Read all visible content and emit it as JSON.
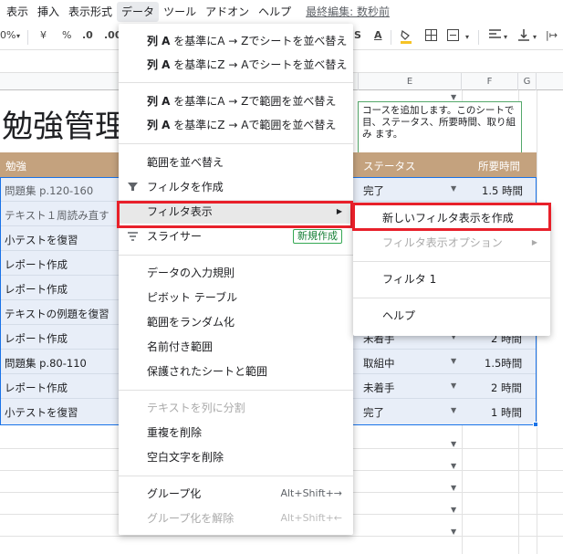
{
  "menubar": {
    "items": [
      "表示",
      "挿入",
      "表示形式",
      "データ",
      "ツール",
      "アドオン",
      "ヘルプ"
    ],
    "active_item": "データ",
    "last_edit": "最終編集: 数秒前"
  },
  "toolbar": {
    "zoom": "0%",
    "currency": "¥",
    "percent": "%",
    "dec_decrease": ".0",
    "dec_increase": ".00"
  },
  "sheet": {
    "columns": [
      "E",
      "F",
      "G"
    ],
    "title": "勉強管理",
    "note_text": "コースを追加します。このシートで 目、ステータス、所要時間、取り組み ます。",
    "headers": {
      "col_a": "勉強",
      "status": "ステータス",
      "time": "所要時間"
    },
    "rows": [
      {
        "task": "問題集 p.120-160",
        "status": "完了",
        "time": "1.5 時間"
      },
      {
        "task": "テキスト１周読み直す",
        "status": "",
        "time": ""
      },
      {
        "task": "小テストを復習",
        "status": "",
        "time": ""
      },
      {
        "task": "レポート作成",
        "status": "",
        "time": ""
      },
      {
        "task": "レポート作成",
        "status": "",
        "time": ""
      },
      {
        "task": "テキストの例題を復習",
        "status": "",
        "time": ""
      },
      {
        "task": "レポート作成",
        "status": "未着手",
        "time": "2 時間"
      },
      {
        "task": "問題集 p.80-110",
        "status": "取組中",
        "time": "1.5時間"
      },
      {
        "task": "レポート作成",
        "status": "未着手",
        "time": "2 時間"
      },
      {
        "task": "小テストを復習",
        "status": "完了",
        "time": "1 時間"
      }
    ]
  },
  "data_menu": {
    "sort_sheet_az": {
      "bold": "列 A",
      "rest": " を基準にA → Zでシートを並べ替え"
    },
    "sort_sheet_za": {
      "bold": "列 A",
      "rest": " を基準にZ → Aでシートを並べ替え"
    },
    "sort_range_az": {
      "bold": "列 A",
      "rest": " を基準にA → Zで範囲を並べ替え"
    },
    "sort_range_za": {
      "bold": "列 A",
      "rest": " を基準にZ → Aで範囲を並べ替え"
    },
    "sort_range": "範囲を並べ替え",
    "create_filter": "フィルタを作成",
    "filter_views": "フィルタ表示",
    "slicer": "スライサー",
    "slicer_badge": "新規作成",
    "data_validation": "データの入力規則",
    "pivot_table": "ピボット テーブル",
    "randomize_range": "範囲をランダム化",
    "named_ranges": "名前付き範囲",
    "protected_sheets": "保護されたシートと範囲",
    "split_text": "テキストを列に分割",
    "remove_duplicates": "重複を削除",
    "trim_whitespace": "空白文字を削除",
    "group": "グループ化",
    "group_shortcut": "Alt+Shift+→",
    "ungroup": "グループ化を解除",
    "ungroup_shortcut": "Alt+Shift+←"
  },
  "filter_submenu": {
    "new_filter_view": "新しいフィルタ表示を作成",
    "filter_view_options": "フィルタ表示オプション",
    "filter_1": "フィルタ 1",
    "help": "ヘルプ"
  },
  "colors": {
    "header_brown": "#c4a27e",
    "data_blue": "#e8eef8",
    "highlight_red": "#e8202a",
    "accent_blue": "#1a73e8"
  }
}
